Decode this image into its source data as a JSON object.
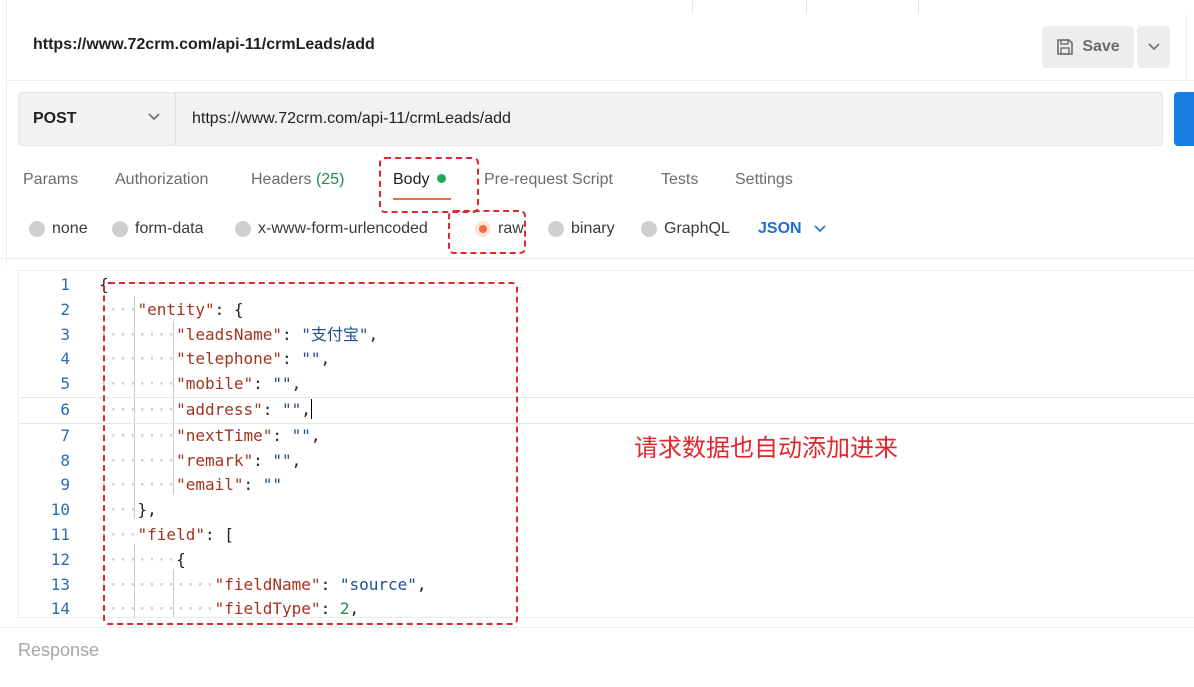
{
  "request": {
    "name": "https://www.72crm.com/api-11/crmLeads/add",
    "save_label": "Save",
    "method": "POST",
    "url": "https://www.72crm.com/api-11/crmLeads/add"
  },
  "tabs": [
    {
      "label": "Params"
    },
    {
      "label": "Authorization"
    },
    {
      "label": "Headers",
      "count": "(25)"
    },
    {
      "label": "Body"
    },
    {
      "label": "Pre-request Script"
    },
    {
      "label": "Tests"
    },
    {
      "label": "Settings"
    }
  ],
  "body_modes": [
    {
      "label": "none"
    },
    {
      "label": "form-data"
    },
    {
      "label": "x-www-form-urlencoded"
    },
    {
      "label": "raw"
    },
    {
      "label": "binary"
    },
    {
      "label": "GraphQL"
    }
  ],
  "format": "JSON",
  "code_lines": [
    {
      "n": "1",
      "text": "{"
    },
    {
      "n": "2",
      "text": "    \"entity\": {"
    },
    {
      "n": "3",
      "text": "        \"leadsName\": \"支付宝\","
    },
    {
      "n": "4",
      "text": "        \"telephone\": \"\","
    },
    {
      "n": "5",
      "text": "        \"mobile\": \"\","
    },
    {
      "n": "6",
      "text": "        \"address\": \"\","
    },
    {
      "n": "7",
      "text": "        \"nextTime\": \"\","
    },
    {
      "n": "8",
      "text": "        \"remark\": \"\","
    },
    {
      "n": "9",
      "text": "        \"email\": \"\""
    },
    {
      "n": "10",
      "text": "    },"
    },
    {
      "n": "11",
      "text": "    \"field\": ["
    },
    {
      "n": "12",
      "text": "        {"
    },
    {
      "n": "13",
      "text": "            \"fieldName\": \"source\","
    },
    {
      "n": "14",
      "text": "            \"fieldType\": 2,"
    }
  ],
  "response_label": "Response",
  "annotation": "请求数据也自动添加进来",
  "colors": {
    "accent_orange": "#f26b3a",
    "send_blue": "#1a7de6",
    "annotation_red": "#e0262e",
    "status_green": "#1fab56"
  }
}
